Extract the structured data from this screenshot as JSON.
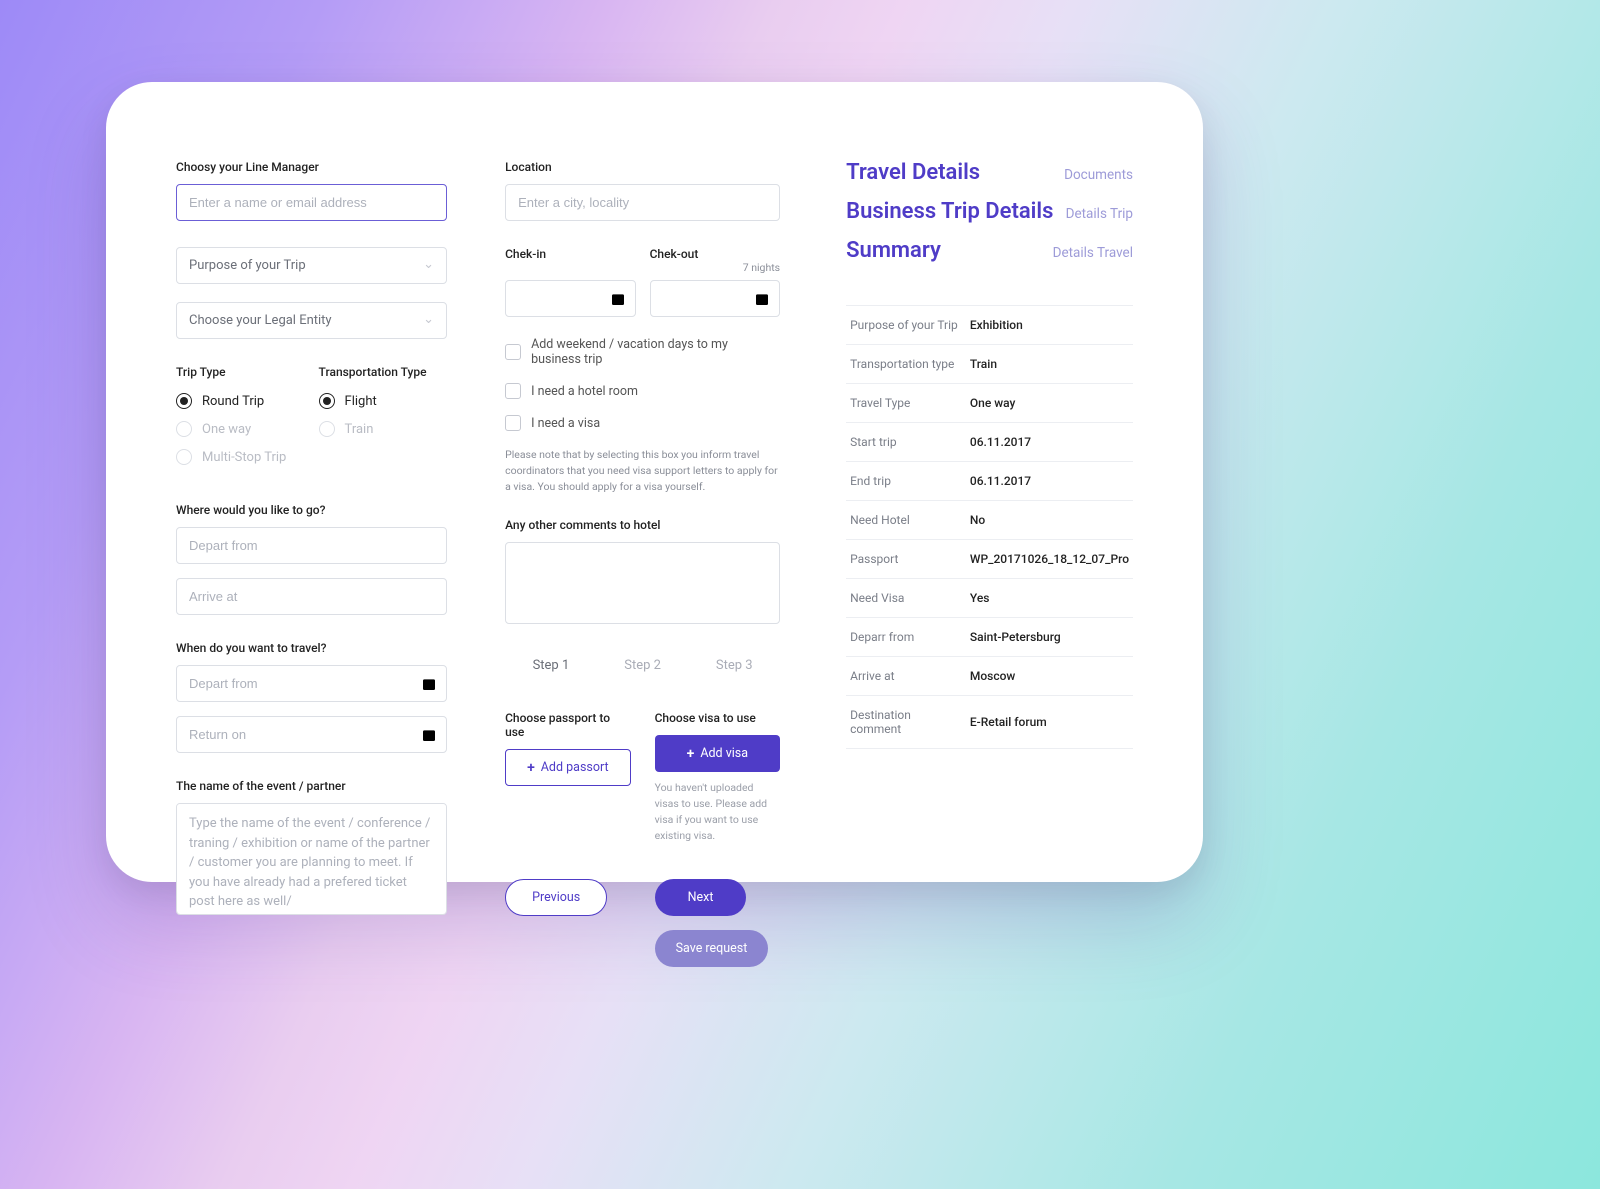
{
  "col1": {
    "lineManager": {
      "label": "Choosy your Line Manager",
      "placeholder": "Enter a name or email address"
    },
    "purpose": {
      "placeholder": "Purpose of your Trip"
    },
    "legalEntity": {
      "placeholder": "Choose your Legal Entity"
    },
    "tripType": {
      "label": "Trip Type",
      "options": [
        "Round Trip",
        "One way",
        "Multi-Stop Trip"
      ],
      "selected": 0
    },
    "transType": {
      "label": "Transportation Type",
      "options": [
        "Flight",
        "Train"
      ],
      "selected": 0
    },
    "whereLabel": "Where would you like to go?",
    "departFromPh": "Depart from",
    "arriveAtPh": "Arrive at",
    "whenLabel": "When do you want to travel?",
    "departDatePh": "Depart from",
    "returnDatePh": "Return on",
    "eventLabel": "The name of the event / partner",
    "eventPh": "Type the name of the event / conference / traning / exhibition or name of the partner / customer you are planning to meet. If you have already had a prefered ticket post here as well/"
  },
  "col2": {
    "locationLabel": "Location",
    "locationPh": "Enter a city, locality",
    "checkinLabel": "Chek-in",
    "checkoutLabel": "Chek-out",
    "nights": "7 nights",
    "cbWeekend": "Add weekend / vacation days to my business trip",
    "cbHotel": "I need a hotel room",
    "cbVisa": "I need a visa",
    "visaNote": "Please note that by selecting this box you inform travel coordinators that you need visa support letters to apply for a visa. You should apply for a visa yourself.",
    "commentsLabel": "Any other comments to hotel",
    "steps": [
      "Step 1",
      "Step 2",
      "Step 3"
    ],
    "passportLabel": "Choose passport to use",
    "addPassport": "Add passort",
    "visaLabel": "Choose visa to use",
    "addVisa": "Add visa",
    "visaHint": "You haven't uploaded visas to use. Please add visa if you want to use existing visa.",
    "previous": "Previous",
    "next": "Next",
    "save": "Save request"
  },
  "col3": {
    "nav": [
      {
        "title": "Travel Details",
        "link": "Documents"
      },
      {
        "title": "Business Trip Details",
        "link": "Details Trip"
      },
      {
        "title": "Summary",
        "link": "Details Travel"
      }
    ],
    "details": [
      [
        "Purpose of your Trip",
        "Exhibition"
      ],
      [
        "Transportation type",
        "Train"
      ],
      [
        "Travel Type",
        "One way"
      ],
      [
        "Start trip",
        "06.11.2017"
      ],
      [
        "End trip",
        "06.11.2017"
      ],
      [
        "Need Hotel",
        "No"
      ],
      [
        "Passport",
        "WP_20171026_18_12_07_Pro"
      ],
      [
        "Need Visa",
        "Yes"
      ],
      [
        "Deparr from",
        "Saint-Petersburg"
      ],
      [
        "Arrive at",
        "Moscow"
      ],
      [
        "Destination comment",
        "E-Retail forum"
      ]
    ]
  }
}
